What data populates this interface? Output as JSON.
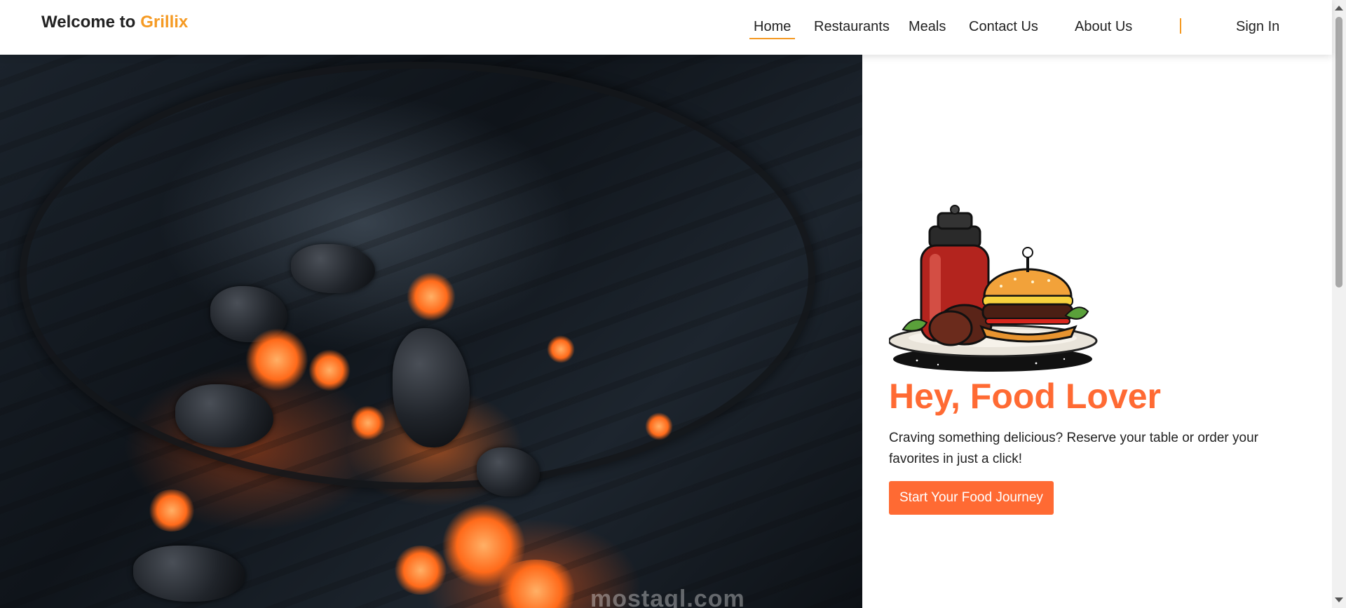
{
  "navbar": {
    "brand_prefix": "Welcome to",
    "brand_name": "Grillix",
    "links": [
      {
        "label": "Home",
        "active": true
      },
      {
        "label": "Restaurants",
        "active": false
      },
      {
        "label": "Meals",
        "active": false
      },
      {
        "label": "Contact Us",
        "active": false
      },
      {
        "label": "About Us",
        "active": false
      }
    ],
    "sign_in": "Sign In"
  },
  "hero": {
    "title": "Hey, Food Lover",
    "text": "Craving something delicious? Reserve your table or order your favorites in just a click!",
    "cta_label": "Start Your Food Journey"
  },
  "watermark": "mostaql.com",
  "colors": {
    "accent": "#f59a23",
    "primary": "#ff6a33",
    "text": "#222222"
  },
  "icons": {
    "food": "burger-and-sauce-jar-icon"
  }
}
